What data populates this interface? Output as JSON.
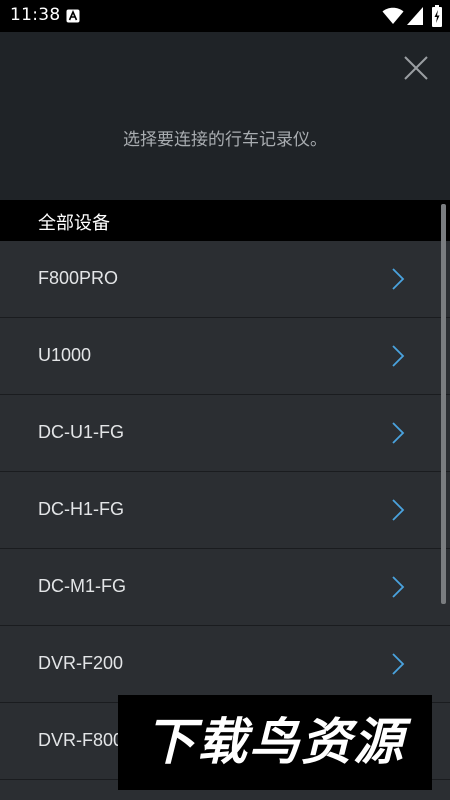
{
  "status_bar": {
    "time": "11:38",
    "notification_icon": "a-letter-icon",
    "wifi_icon": "wifi-icon",
    "signal_icon": "signal-icon",
    "battery_icon": "battery-charging-icon"
  },
  "header": {
    "close_icon": "close-icon",
    "subtitle": "选择要连接的行车记录仪。"
  },
  "section": {
    "title": "全部设备"
  },
  "devices": [
    {
      "label": "F800PRO"
    },
    {
      "label": "U1000"
    },
    {
      "label": "DC-U1-FG"
    },
    {
      "label": "DC-H1-FG"
    },
    {
      "label": "DC-M1-FG"
    },
    {
      "label": "DVR-F200"
    },
    {
      "label": "DVR-F800"
    }
  ],
  "watermark": {
    "text": "下载鸟资源"
  },
  "colors": {
    "background": "#1f2327",
    "list_background": "#2b2e32",
    "accent_chevron": "#4aa3df",
    "status_bar": "#000000"
  }
}
